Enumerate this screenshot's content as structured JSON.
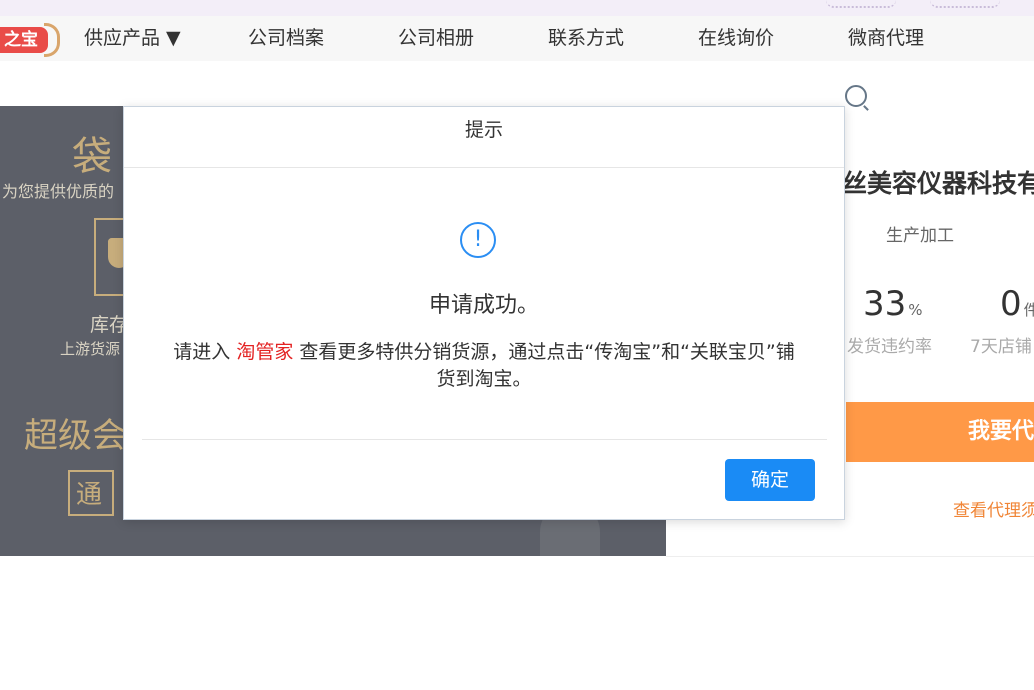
{
  "nav": {
    "logo_text": "之宝",
    "items": [
      {
        "label": "供应产品 ▼"
      },
      {
        "label": "公司档案"
      },
      {
        "label": "公司相册"
      },
      {
        "label": "联系方式"
      },
      {
        "label": "在线询价"
      },
      {
        "label": "微商代理"
      }
    ]
  },
  "banner": {
    "title": "袋",
    "subtitle": "为您提供优质的",
    "stock_label": "库存",
    "stock_sub": "上游货源",
    "vip_title": "超级会",
    "tong": "通"
  },
  "right_panel": {
    "company_name": "丝美容仪器科技有",
    "business_type": "生产加工",
    "stats": [
      {
        "value": "33",
        "unit": "%",
        "label": "发货违约率"
      },
      {
        "value": "0",
        "unit": "件",
        "label": "7天店铺"
      }
    ],
    "agent_button": "我要代",
    "agent_link": "查看代理须"
  },
  "modal": {
    "title": "提示",
    "icon": "!",
    "heading": "申请成功。",
    "message_prefix": "请进入",
    "message_highlight": "淘管家",
    "message_suffix": "查看更多特供分销货源，通过点击“传淘宝”和“关联宝贝”铺货到淘宝。",
    "confirm_label": "确定"
  },
  "colors": {
    "confirm": "#1a8bf5",
    "agent_button": "#ff9947",
    "highlight": "#e32222",
    "info": "#2b8ef3"
  }
}
